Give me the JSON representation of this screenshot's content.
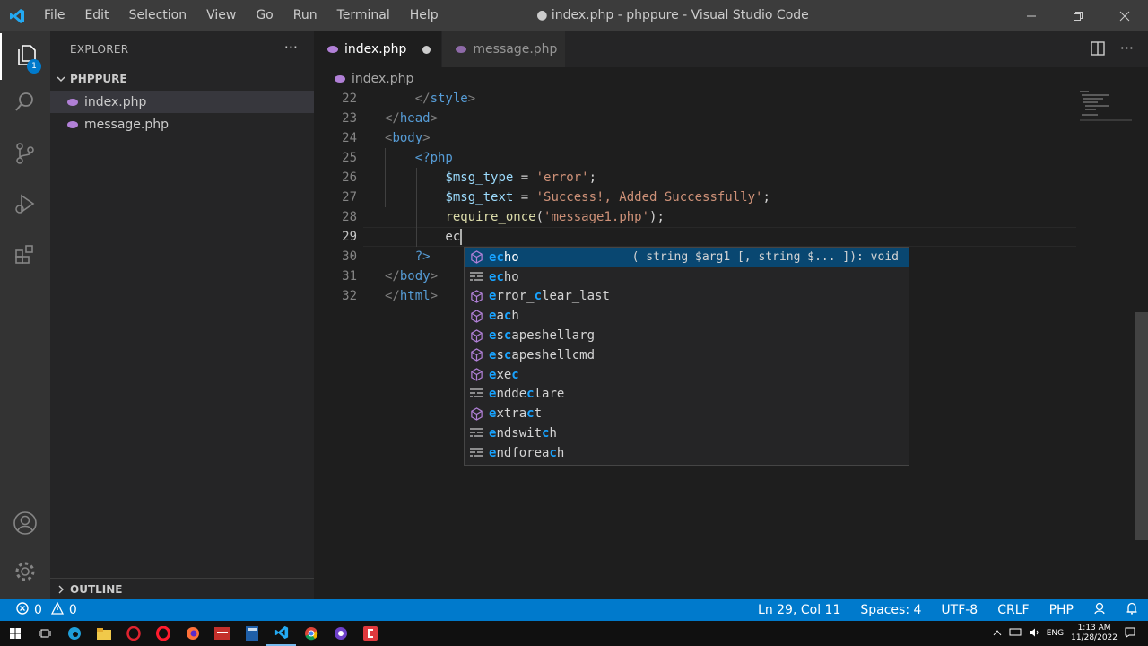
{
  "titlebar": {
    "menu": [
      "File",
      "Edit",
      "Selection",
      "View",
      "Go",
      "Run",
      "Terminal",
      "Help"
    ],
    "window_title": "● index.php - phppure - Visual Studio Code"
  },
  "activity": {
    "explorer_badge": "1"
  },
  "sidebar": {
    "title": "EXPLORER",
    "folder": "PHPPURE",
    "files": [
      "index.php",
      "message.php"
    ],
    "outline": "OUTLINE"
  },
  "tabs": [
    {
      "label": "index.php",
      "active": true,
      "dirty": true
    },
    {
      "label": "message.php",
      "active": false,
      "dirty": false
    }
  ],
  "breadcrumb": "index.php",
  "code": {
    "lines": [
      {
        "num": "22",
        "text": "    </style>"
      },
      {
        "num": "23",
        "text": "</head>"
      },
      {
        "num": "24",
        "text": "<body>"
      },
      {
        "num": "25",
        "text": "    <?php"
      },
      {
        "num": "26",
        "text": "        $msg_type = 'error';"
      },
      {
        "num": "27",
        "text": "        $msg_text = 'Success!, Added Successfully';"
      },
      {
        "num": "28",
        "text": "        require_once('message1.php');"
      },
      {
        "num": "29",
        "text": "        ec"
      },
      {
        "num": "30",
        "text": "    ?>"
      },
      {
        "num": "31",
        "text": "</body>"
      },
      {
        "num": "32",
        "text": "</html>"
      }
    ]
  },
  "suggest": {
    "detail": "( string $arg1 [, string $... ]): void",
    "items": [
      {
        "label": "echo",
        "kind": "function"
      },
      {
        "label": "echo",
        "kind": "keyword"
      },
      {
        "label": "error_clear_last",
        "kind": "function"
      },
      {
        "label": "each",
        "kind": "function"
      },
      {
        "label": "escapeshellarg",
        "kind": "function"
      },
      {
        "label": "escapeshellcmd",
        "kind": "function"
      },
      {
        "label": "exec",
        "kind": "function"
      },
      {
        "label": "enddeclare",
        "kind": "keyword"
      },
      {
        "label": "extract",
        "kind": "function"
      },
      {
        "label": "endswitch",
        "kind": "keyword"
      },
      {
        "label": "endforeach",
        "kind": "keyword"
      }
    ]
  },
  "status": {
    "errors": "0",
    "warnings": "0",
    "position": "Ln 29, Col 11",
    "spaces": "Spaces: 4",
    "encoding": "UTF-8",
    "eol": "CRLF",
    "language": "PHP"
  },
  "taskbar": {
    "lang": "ENG",
    "time": "1:13 AM",
    "date": "11/28/2022"
  },
  "colors": {
    "accent": "#007acc",
    "focused_item": "#094771",
    "match_highlight": "#18a3ff",
    "php_icon": "#b180d7"
  }
}
